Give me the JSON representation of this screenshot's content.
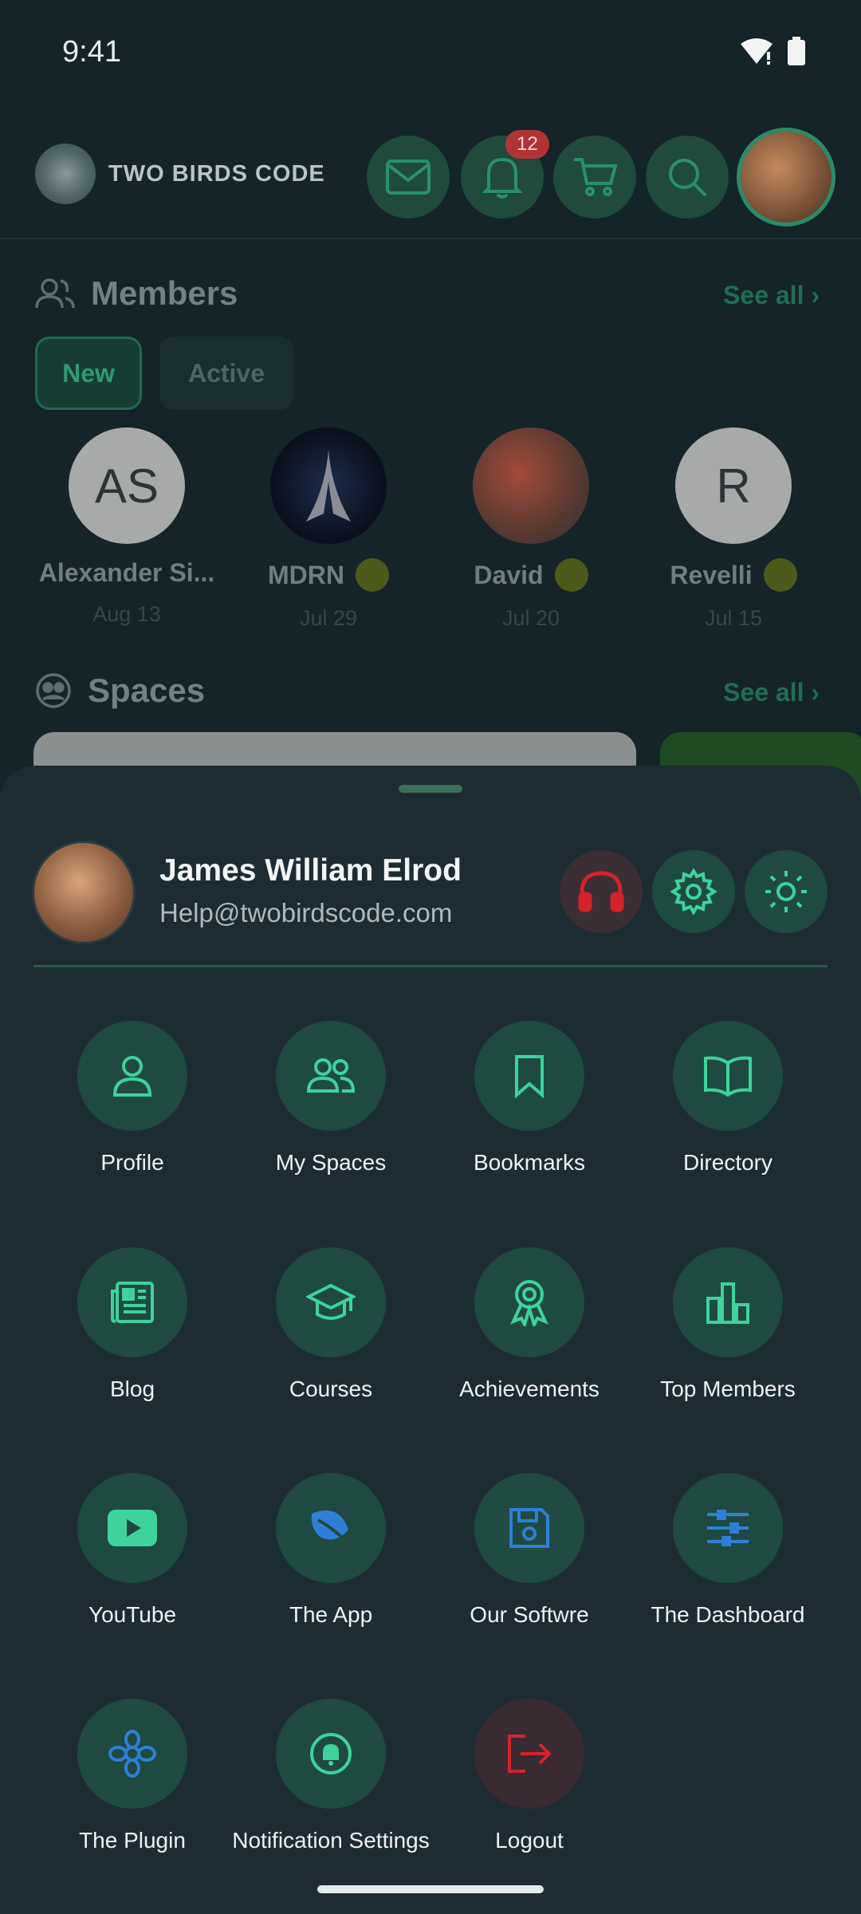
{
  "status_bar": {
    "time": "9:41"
  },
  "header": {
    "logo_text": "TWO BIRDS CODE",
    "notification_count": "12",
    "icons": [
      "mail-icon",
      "bell-icon",
      "cart-icon",
      "search-icon"
    ]
  },
  "members": {
    "title": "Members",
    "see_all": "See all",
    "filters": [
      "New",
      "Active"
    ],
    "items": [
      {
        "initials": "AS",
        "name": "Alexander Si...",
        "date": "Aug 13"
      },
      {
        "initials": "",
        "name": "MDRN",
        "date": "Jul 29"
      },
      {
        "initials": "",
        "name": "David",
        "date": "Jul 20"
      },
      {
        "initials": "R",
        "name": "Revelli",
        "date": "Jul 15"
      }
    ]
  },
  "spaces": {
    "title": "Spaces",
    "see_all": "See all"
  },
  "sheet": {
    "user_name": "James William Elrod",
    "user_email": "Help@twobirdscode.com",
    "menu": [
      {
        "label": "Profile",
        "icon": "user-icon"
      },
      {
        "label": "My Spaces",
        "icon": "users-icon"
      },
      {
        "label": "Bookmarks",
        "icon": "bookmark-icon"
      },
      {
        "label": "Directory",
        "icon": "book-icon"
      },
      {
        "label": "Blog",
        "icon": "newspaper-icon"
      },
      {
        "label": "Courses",
        "icon": "graduation-cap-icon"
      },
      {
        "label": "Achievements",
        "icon": "award-icon"
      },
      {
        "label": "Top Members",
        "icon": "bar-chart-icon"
      },
      {
        "label": "YouTube",
        "icon": "youtube-icon"
      },
      {
        "label": "The App",
        "icon": "leaf-icon"
      },
      {
        "label": "Our Softwre",
        "icon": "floppy-disk-icon"
      },
      {
        "label": "The Dashboard",
        "icon": "sliders-icon"
      },
      {
        "label": "The Plugin",
        "icon": "flower-icon"
      },
      {
        "label": "Notification Settings",
        "icon": "bell-settings-icon"
      },
      {
        "label": "Logout",
        "icon": "logout-icon"
      }
    ]
  },
  "colors": {
    "accent": "#3ed39c",
    "blue": "#2f7fd6",
    "danger": "#d4232b"
  }
}
